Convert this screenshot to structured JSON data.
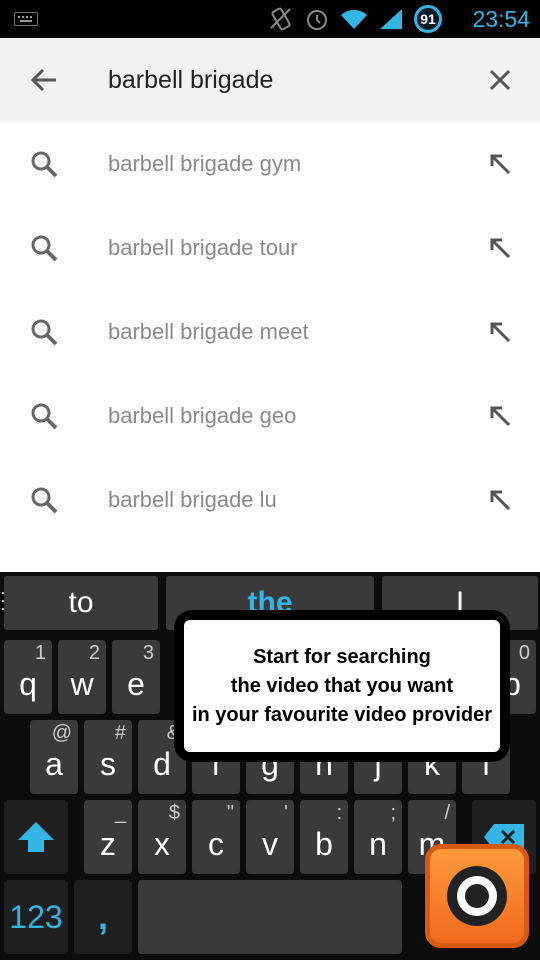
{
  "status": {
    "battery": "91",
    "time": "23:54"
  },
  "search": {
    "query": "barbell brigade"
  },
  "suggestions": [
    {
      "text": "barbell brigade gym"
    },
    {
      "text": "barbell brigade tour"
    },
    {
      "text": "barbell brigade meet"
    },
    {
      "text": "barbell brigade geo"
    },
    {
      "text": "barbell brigade lu"
    }
  ],
  "keyboard": {
    "candidates": [
      "to",
      "the",
      "I"
    ],
    "row1": [
      {
        "k": "q",
        "h": "1"
      },
      {
        "k": "w",
        "h": "2"
      },
      {
        "k": "e",
        "h": "3"
      },
      {
        "k": "p",
        "h": "0"
      }
    ],
    "row2": [
      {
        "k": "a",
        "h": "@"
      },
      {
        "k": "s",
        "h": "#"
      },
      {
        "k": "d",
        "h": "&"
      },
      {
        "k": "f",
        "h": ""
      },
      {
        "k": "g",
        "h": ""
      },
      {
        "k": "h",
        "h": ""
      },
      {
        "k": "j",
        "h": ""
      },
      {
        "k": "k",
        "h": ""
      },
      {
        "k": "l",
        "h": ""
      }
    ],
    "row3": [
      {
        "k": "z",
        "h": "_"
      },
      {
        "k": "x",
        "h": "$"
      },
      {
        "k": "c",
        "h": "\""
      },
      {
        "k": "v",
        "h": "'"
      },
      {
        "k": "b",
        "h": ":"
      },
      {
        "k": "n",
        "h": ";"
      },
      {
        "k": "m",
        "h": "/"
      }
    ],
    "numbers_key": "123",
    "comma_key": ","
  },
  "tooltip": {
    "lines": [
      "Start for searching",
      "the video that you want",
      "in your favourite video provider"
    ]
  },
  "colors": {
    "accent": "#33b5e5",
    "logo": "#f47b20"
  }
}
